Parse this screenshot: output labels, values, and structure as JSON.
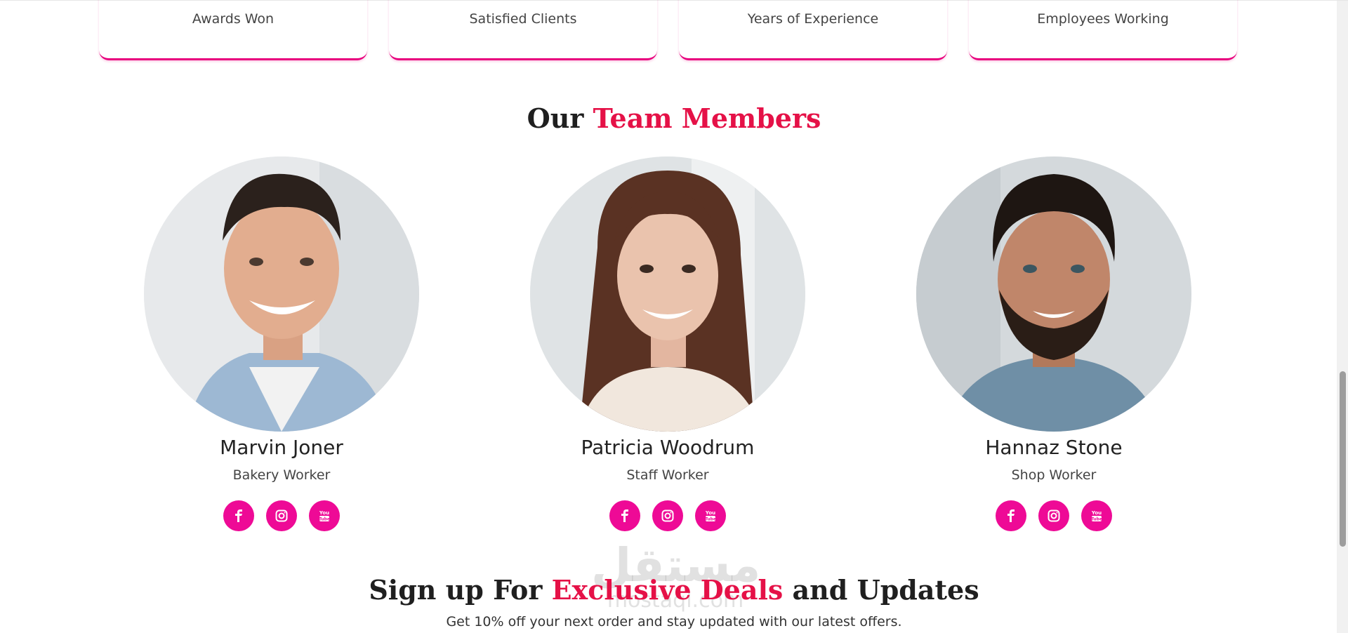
{
  "stats": [
    {
      "label": "Awards Won"
    },
    {
      "label": "Satisfied Clients"
    },
    {
      "label": "Years of Experience"
    },
    {
      "label": "Employees Working"
    }
  ],
  "team": {
    "title_prefix": "Our",
    "title_accent": "Team Members",
    "members": [
      {
        "name": "Marvin Joner",
        "role": "Bakery Worker"
      },
      {
        "name": "Patricia Woodrum",
        "role": "Staff Worker"
      },
      {
        "name": "Hannaz Stone",
        "role": "Shop Worker"
      }
    ],
    "social_icons": [
      "facebook-icon",
      "instagram-icon",
      "youtube-icon"
    ]
  },
  "signup": {
    "title_prefix": "Sign up For",
    "title_accent": "Exclusive Deals",
    "title_suffix": "and Updates",
    "subtitle": "Get 10% off your next order and stay updated with our latest offers."
  },
  "watermark": {
    "arabic": "مستقل",
    "latin": "mostaql.com"
  },
  "colors": {
    "accent": "#e51147",
    "social": "#ee0a96",
    "stat_border": "#e8007e"
  }
}
